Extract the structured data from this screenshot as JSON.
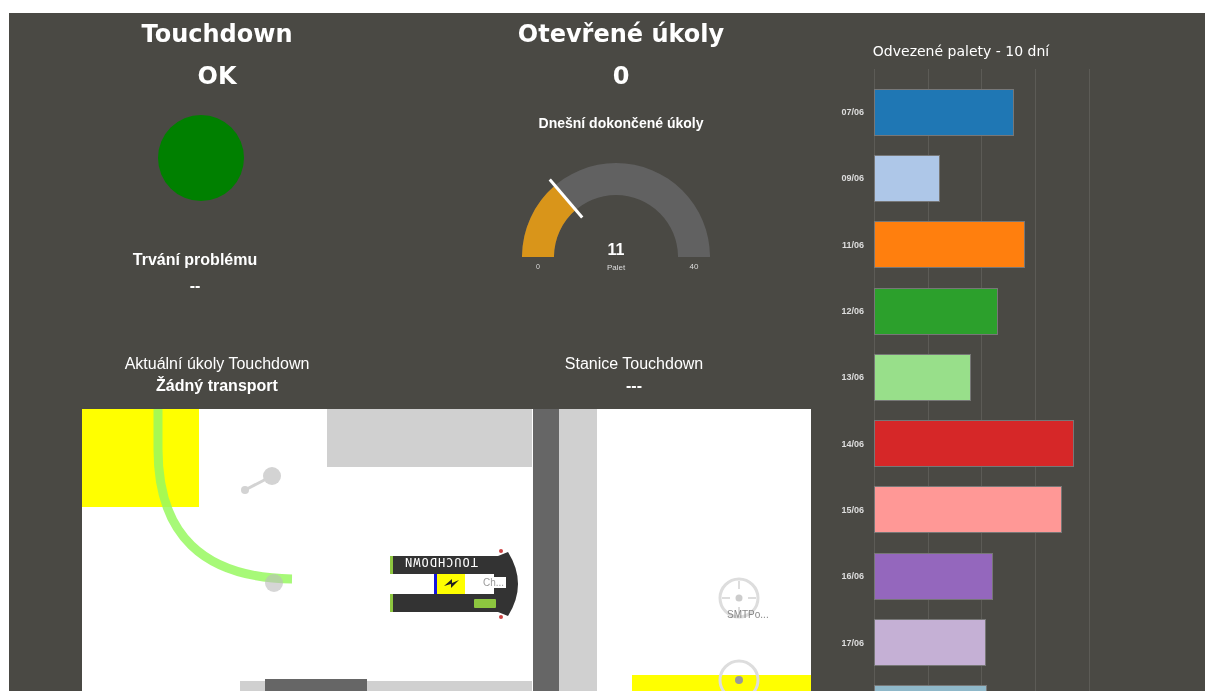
{
  "touchdown": {
    "title": "Touchdown",
    "status": "OK",
    "problem_label": "Trvání problému",
    "problem_value": "--"
  },
  "open_tasks": {
    "title": "Otevřené úkoly",
    "value": "0"
  },
  "gauge": {
    "title": "Dnešní dokončené úkoly",
    "value": "11",
    "unit": "Palet",
    "min": "0",
    "max": "40"
  },
  "current_tasks": {
    "title": "Aktuální úkoly Touchdown",
    "value": "Žádný transport"
  },
  "station": {
    "title": "Stanice Touchdown",
    "value": "---"
  },
  "map": {
    "robot_label": "TOUCHDOWN",
    "robot_station": "Ch...",
    "station_label": "SMTPo..."
  },
  "pallets_chart": {
    "title": "Odvezené palety - 10 dní",
    "bars": [
      {
        "label": "07/06",
        "color": "#1f77b4"
      },
      {
        "label": "09/06",
        "color": "#aec7e8"
      },
      {
        "label": "11/06",
        "color": "#ff7f0e"
      },
      {
        "label": "12/06",
        "color": "#2ca02c"
      },
      {
        "label": "13/06",
        "color": "#98df8a"
      },
      {
        "label": "14/06",
        "color": "#d62728"
      },
      {
        "label": "15/06",
        "color": "#ff9896"
      },
      {
        "label": "16/06",
        "color": "#9467bd"
      },
      {
        "label": "17/06",
        "color": "#c5b0d5"
      },
      {
        "color": "#8fb8c9"
      }
    ]
  }
}
